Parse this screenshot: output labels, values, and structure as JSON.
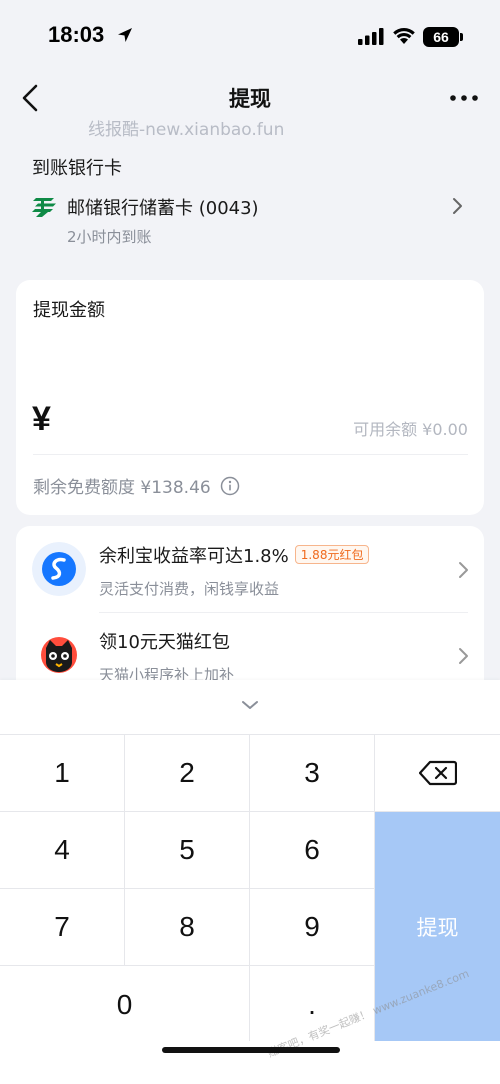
{
  "status_bar": {
    "time": "18:03",
    "battery": "66"
  },
  "nav": {
    "title": "提现"
  },
  "watermark": "线报酷-new.xianbao.fun",
  "bank": {
    "section_title": "到账银行卡",
    "name": "邮储银行储蓄卡 (0043)",
    "arrival_time": "2小时内到账"
  },
  "amount": {
    "label": "提现金额",
    "currency": "¥",
    "available_placeholder": "可用余额 ¥0.00",
    "free_quota": "剩余免费额度 ¥138.46"
  },
  "promos": [
    {
      "title": "余利宝收益率可达1.8%",
      "badge": "1.88元红包",
      "subtitle": "灵活支付消费，闲钱享收益"
    },
    {
      "title": "领10元天猫红包",
      "badge": "",
      "subtitle": "天猫小程序补上加补"
    }
  ],
  "keyboard": {
    "keys": [
      "1",
      "2",
      "3",
      "4",
      "5",
      "6",
      "7",
      "8",
      "9",
      "0",
      "."
    ],
    "confirm_label": "提现"
  },
  "corner_watermark": "赚客吧，有奖一起赚！ www.zuanke8.com",
  "colors": {
    "confirm": "#a6c8f6",
    "accent": "#1677ff",
    "badge": "#f06a1d"
  }
}
